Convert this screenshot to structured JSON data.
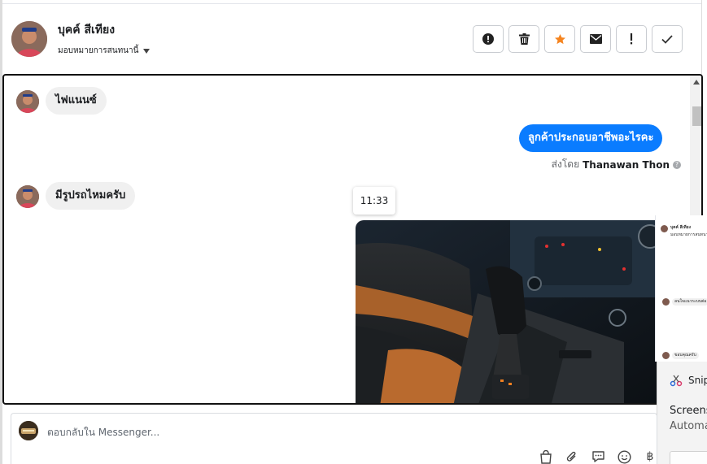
{
  "contact": {
    "name": "บุคค์ สีเทียง",
    "assign_label": "มอบหมายการสนทนานี้"
  },
  "actions": [
    {
      "name": "mark-spam-button",
      "icon": "alert-circle-icon"
    },
    {
      "name": "delete-button",
      "icon": "trash-icon"
    },
    {
      "name": "star-button",
      "icon": "star-icon"
    },
    {
      "name": "mark-unread-button",
      "icon": "envelope-icon"
    },
    {
      "name": "follow-up-button",
      "icon": "exclamation-icon"
    },
    {
      "name": "mark-done-button",
      "icon": "check-icon"
    }
  ],
  "messages": {
    "incoming_1": "ไฟแนนซ์",
    "outgoing_1": "ลูกค้าประกอบอาชีพอะไรคะ",
    "sent_by_prefix": "ส่งโดย",
    "sent_by_name": "Thanawan Thon",
    "incoming_2": "มีรูปรถไหมครับ",
    "timestamp": "11:33"
  },
  "preview_panel": {
    "name": "บุคค์ สีเทียง",
    "sub": "มอบหมายการสนทนานี้",
    "msg1": "ลนใจแนวระบบต่อ",
    "msg2": "ขอบคุณครับ"
  },
  "snip": {
    "title": "Snip",
    "line1": "Screens",
    "line2": "Automa"
  },
  "composer": {
    "placeholder": "ตอบกลับใน Messenger...",
    "currency_symbol": "฿"
  },
  "colors": {
    "accent": "#0a7cff",
    "star": "#f5841f"
  }
}
